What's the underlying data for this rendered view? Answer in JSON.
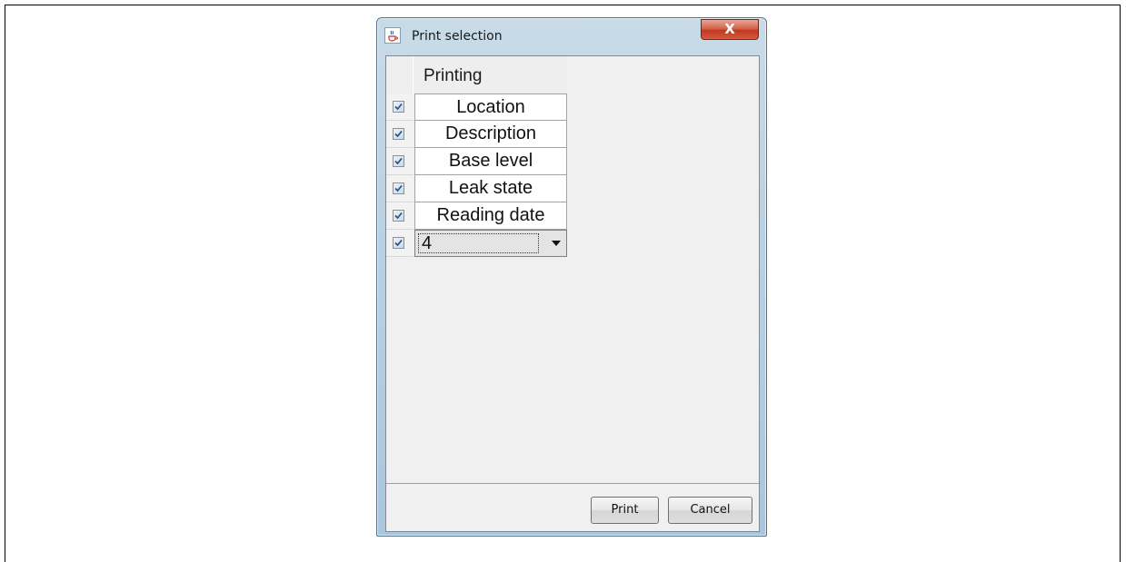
{
  "window": {
    "title": "Print selection",
    "close_label": "X",
    "app_icon": "java-cup-icon"
  },
  "table": {
    "header": "Printing",
    "rows": [
      {
        "checked": true,
        "label": "Location"
      },
      {
        "checked": true,
        "label": "Description"
      },
      {
        "checked": true,
        "label": "Base level"
      },
      {
        "checked": true,
        "label": "Leak state"
      },
      {
        "checked": true,
        "label": "Reading date"
      }
    ],
    "combo_row": {
      "checked": true,
      "value": "4"
    }
  },
  "buttons": {
    "print": "Print",
    "cancel": "Cancel"
  }
}
